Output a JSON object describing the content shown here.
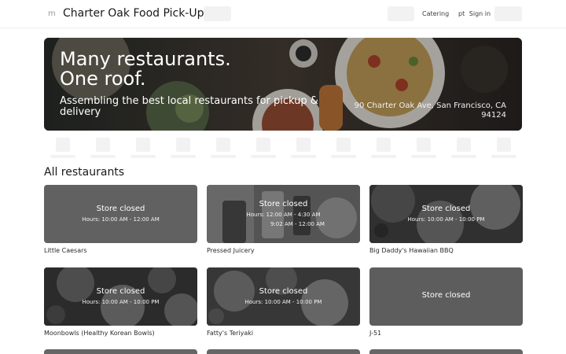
{
  "header": {
    "menu_glyph": "m",
    "title": "Charter Oak Food Pick-Up",
    "catering_label": "Catering",
    "signin_prefix": "pt",
    "signin_label": "Sign in"
  },
  "hero": {
    "title": "Many restaurants.\nOne roof.",
    "subtitle": "Assembling the best local restaurants for pickup & delivery",
    "address": "90 Charter Oak Ave, San Francisco, CA 94124"
  },
  "section_title": "All restaurants",
  "restaurants": [
    {
      "name": "Little Caesars",
      "status": "Store closed",
      "hours": [
        "Hours: 10:00 AM - 12:00 AM"
      ]
    },
    {
      "name": "Pressed Juicery",
      "status": "Store closed",
      "hours": [
        "Hours: 12:00 AM - 4:30 AM",
        "9:02 AM - 12:00 AM"
      ]
    },
    {
      "name": "Big Daddy's Hawaiian BBQ",
      "status": "Store closed",
      "hours": [
        "Hours: 10:00 AM - 10:00 PM"
      ]
    },
    {
      "name": "Moonbowls (Healthy Korean Bowls)",
      "status": "Store closed",
      "hours": [
        "Hours: 10:00 AM - 10:00 PM"
      ]
    },
    {
      "name": "Fatty's Teriyaki",
      "status": "Store closed",
      "hours": [
        "Hours: 10:00 AM - 10:00 PM"
      ]
    },
    {
      "name": "J-51",
      "status": "Store closed",
      "hours": []
    }
  ]
}
